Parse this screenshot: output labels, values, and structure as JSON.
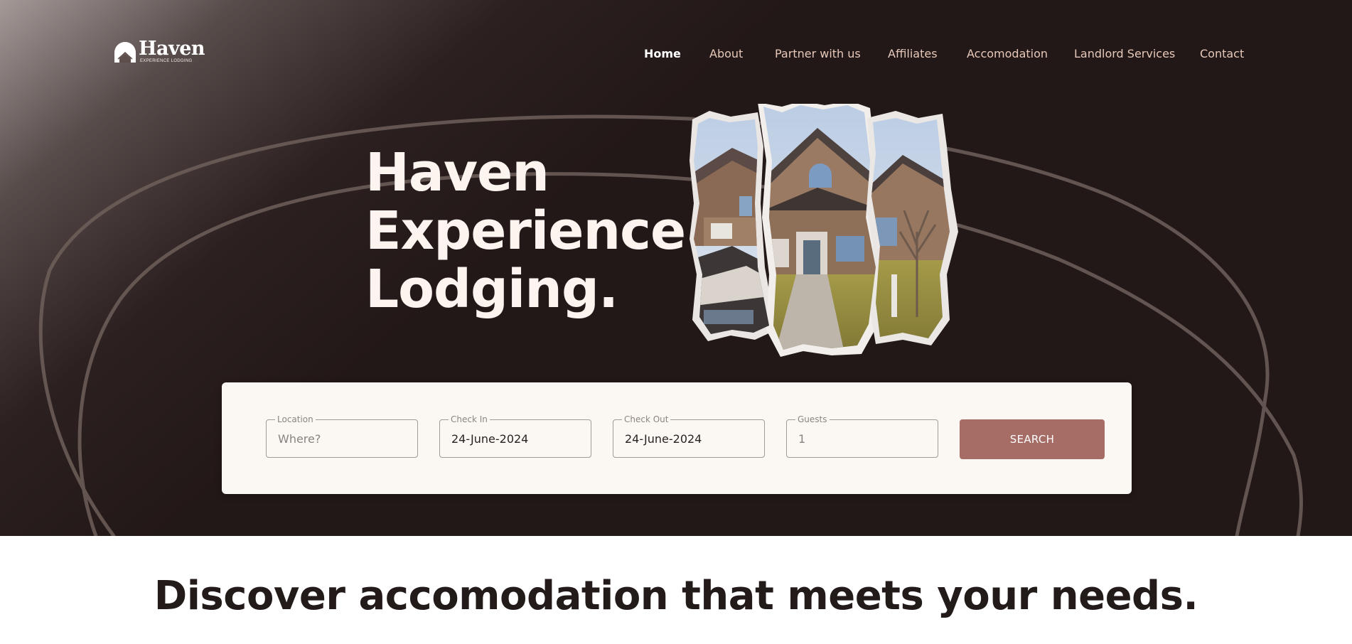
{
  "brand": {
    "name": "Haven",
    "tagline": "EXPERIENCE LODGING",
    "logo_icon": "house-arch-icon"
  },
  "nav": {
    "items": [
      {
        "label": "Home",
        "active": true
      },
      {
        "label": "About",
        "active": false
      },
      {
        "label": "Partner with us",
        "active": false
      },
      {
        "label": "Affiliates",
        "active": false
      },
      {
        "label": "Accomodation",
        "active": false
      },
      {
        "label": "Landlord Services",
        "active": false
      },
      {
        "label": "Contact",
        "active": false
      }
    ]
  },
  "hero": {
    "title_lines": [
      "Haven",
      "Experience",
      "Lodging."
    ],
    "image_subject": "torn-paper collage of a brick suburban house"
  },
  "search": {
    "location": {
      "label": "Location",
      "placeholder": "Where?",
      "value": ""
    },
    "check_in": {
      "label": "Check In",
      "value": "24-June-2024"
    },
    "check_out": {
      "label": "Check Out",
      "value": "24-June-2024"
    },
    "guests": {
      "label": "Guests",
      "placeholder": "1",
      "value": ""
    },
    "button_label": "SEARCH"
  },
  "section": {
    "heading": "Discover accomodation that meets your needs."
  },
  "colors": {
    "hero_bg": "#231818",
    "nav_text": "#e6c9ba",
    "card_bg": "#fbf7f3",
    "button": "#a66c66",
    "heading_dark": "#231a1a"
  }
}
